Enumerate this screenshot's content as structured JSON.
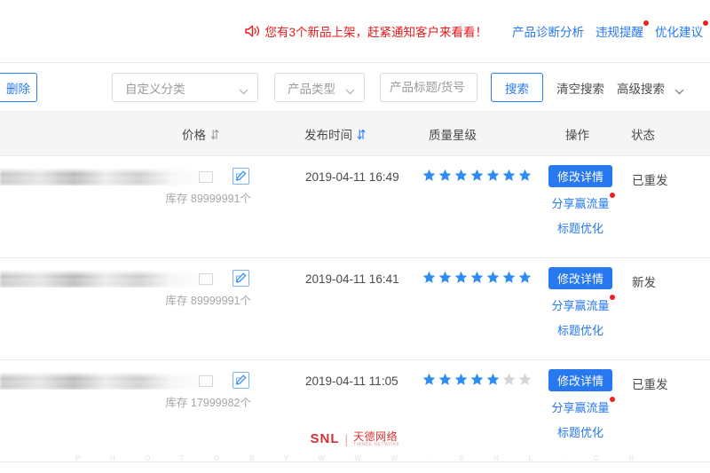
{
  "notice": {
    "speaker_icon": "speaker-icon",
    "text": "您有3个新品上架，赶紧通知客户来看看！",
    "links": [
      {
        "label": "产品诊断分析",
        "badge": false
      },
      {
        "label": "违规提醒",
        "badge": true
      },
      {
        "label": "优化建议",
        "badge": true
      }
    ]
  },
  "filter": {
    "delete_label": "删除",
    "category_select": {
      "value": "自定义分类",
      "icon": "chevron-down-icon"
    },
    "type_select": {
      "value": "产品类型",
      "icon": "chevron-down-icon"
    },
    "keyword_input": {
      "value": "",
      "placeholder": "产品标题/货号"
    },
    "search_label": "搜索",
    "clear_label": "清空搜索",
    "advanced_label": "高级搜索",
    "advanced_icon": "chevron-down-icon"
  },
  "table": {
    "headers": [
      {
        "label": "价格",
        "sort_icon": "sort-both-icon",
        "sort_active": false
      },
      {
        "label": "发布时间",
        "sort_icon": "sort-both-icon",
        "sort_active": true
      },
      {
        "label": "质量星级",
        "sort_icon": "",
        "sort_active": false
      },
      {
        "label": "操作",
        "sort_icon": "",
        "sort_active": false
      },
      {
        "label": "状态",
        "sort_icon": "",
        "sort_active": false
      }
    ],
    "star_total": 7,
    "rows": [
      {
        "price": "",
        "price_redacted": true,
        "edit_icon": "edit-pencil-icon",
        "stock": "库存 89999991个",
        "date": "2019-04-11 16:49",
        "stars_filled": 7,
        "modify_label": "修改详情",
        "share_label": "分享赢流量",
        "share_badge": true,
        "title_opt_label": "标题优化",
        "status": "已重发"
      },
      {
        "price": "",
        "price_redacted": true,
        "edit_icon": "edit-pencil-icon",
        "stock": "库存 89999991个",
        "date": "2019-04-11 16:41",
        "stars_filled": 7,
        "modify_label": "修改详情",
        "share_label": "分享赢流量",
        "share_badge": true,
        "title_opt_label": "标题优化",
        "status": "新发"
      },
      {
        "price": "",
        "price_redacted": true,
        "edit_icon": "edit-pencil-icon",
        "stock": "库存 17999982个",
        "date": "2019-04-11 11:05",
        "stars_filled": 5,
        "modify_label": "修改详情",
        "share_label": "分享赢流量",
        "share_badge": true,
        "title_opt_label": "标题优化",
        "status": "已重发"
      }
    ]
  },
  "watermark": {
    "logo_main": "SNL",
    "logo_sep": "|",
    "logo_cn": "天德网络",
    "logo_cn_sub": "TIANDE NETWORK",
    "bottom_chars": [
      "P",
      "H",
      "O",
      "T",
      "O",
      "B",
      "Y",
      "W",
      "W",
      "W",
      ".",
      "S",
      "N",
      "L",
      ".",
      "C",
      "N"
    ]
  },
  "colors": {
    "accent_blue": "#2878f0",
    "notice_red": "#e8191b",
    "badge_red": "#f21f1f",
    "star_on": "#2e8cf5",
    "star_off": "#d6d6d6",
    "header_bg": "#f5f5f5",
    "border": "#ebebeb"
  }
}
